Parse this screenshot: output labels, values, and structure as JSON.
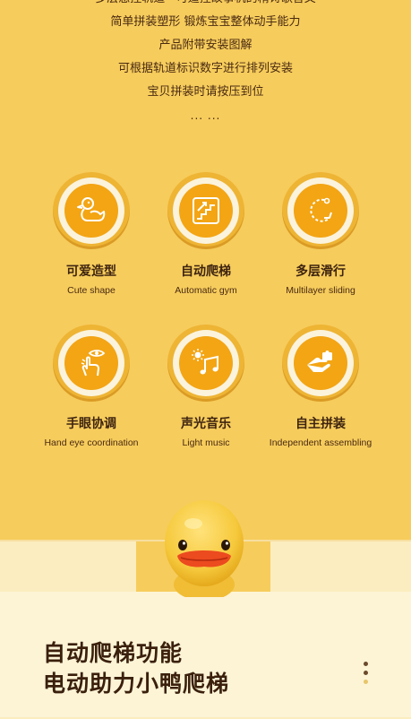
{
  "intro": {
    "lines": [
      "多层急控轨道 · 可遥控故事机的精诗歌音文",
      "简单拼装塑形 锻炼宝宝整体动手能力",
      "产品附带安装图解",
      "可根据轨道标识数字进行排列安装",
      "宝贝拼装时请按压到位",
      "... ..."
    ]
  },
  "features": [
    {
      "cn": "可爱造型",
      "en": "Cute shape",
      "icon": "duck-icon"
    },
    {
      "cn": "自动爬梯",
      "en": "Automatic gym",
      "icon": "stairs-icon"
    },
    {
      "cn": "多层滑行",
      "en": "Multilayer sliding",
      "icon": "sliding-arrow-icon"
    },
    {
      "cn": "手眼协调",
      "en": "Hand eye coordination",
      "icon": "hand-eye-icon"
    },
    {
      "cn": "声光音乐",
      "en": "Light music",
      "icon": "light-music-icon"
    },
    {
      "cn": "自主拼装",
      "en": "Independent assembling",
      "icon": "assembling-hand-icon"
    }
  ],
  "headline": {
    "line1": "自动爬梯功能",
    "line2": "电动助力小鸭爬梯"
  },
  "colors": {
    "background": "#f6cc5c",
    "icon_orange": "#f3a514",
    "panel": "#fdf4d6",
    "text_dark": "#3a200d"
  }
}
